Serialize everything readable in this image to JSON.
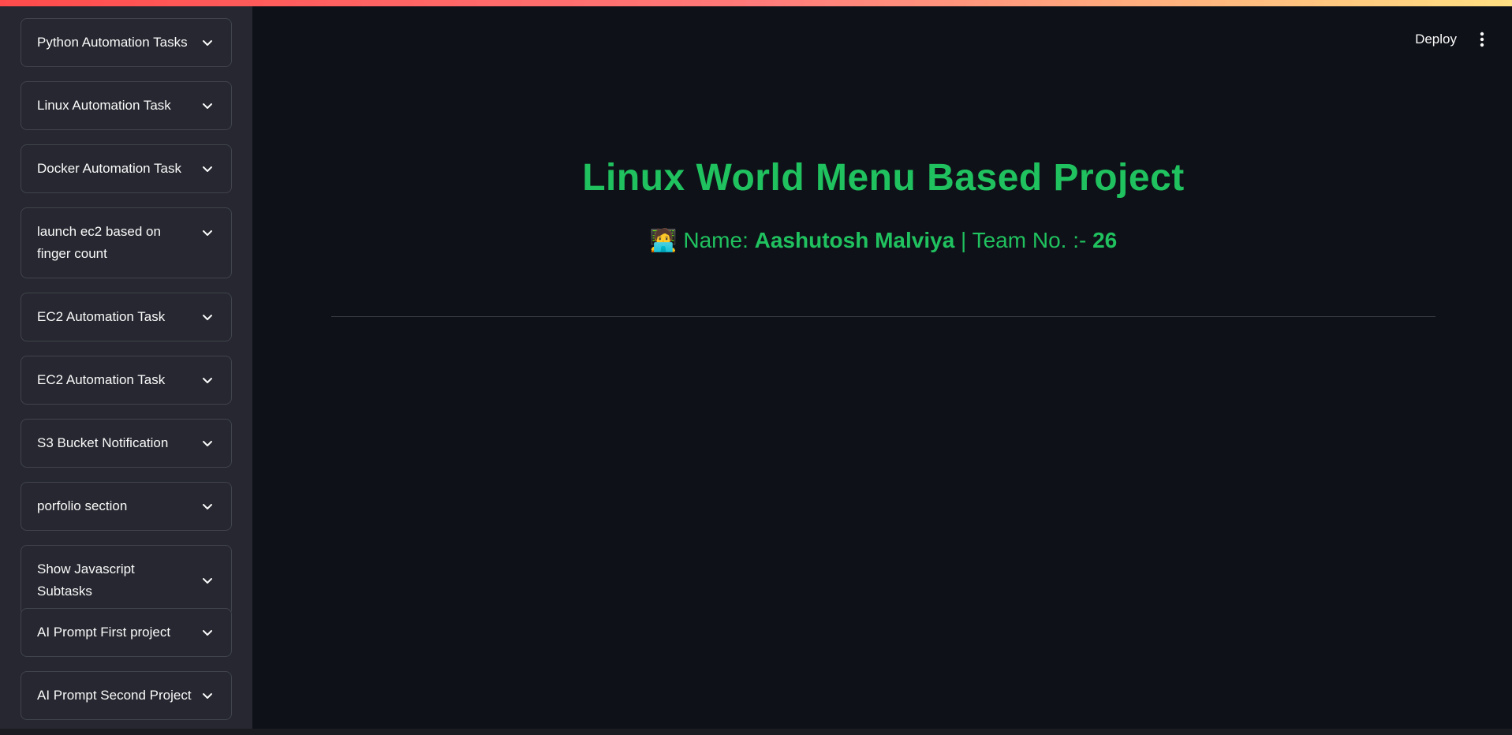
{
  "sidebar": {
    "items": [
      {
        "label": "Python Automation Tasks"
      },
      {
        "label": "Linux Automation Task"
      },
      {
        "label": "Docker Automation Task"
      },
      {
        "label": "launch ec2 based on finger count"
      },
      {
        "label": "EC2 Automation Task"
      },
      {
        "label": "EC2 Automation Task"
      },
      {
        "label": "S3 Bucket Notification"
      },
      {
        "label": "porfolio section"
      },
      {
        "label": "Show Javascript Subtasks"
      },
      {
        "label": "AI Prompt First project"
      },
      {
        "label": "AI Prompt Second Project"
      }
    ]
  },
  "header": {
    "deploy_label": "Deploy",
    "menu_icon": "kebab-menu-icon"
  },
  "main": {
    "title": "Linux World Menu Based Project",
    "subtitle": {
      "emoji": "🧑‍💻",
      "name_prefix": "Name: ",
      "name": "Aashutosh Malviya",
      "separator": " | Team No. :- ",
      "team_no": "26"
    }
  },
  "colors": {
    "accent_green": "#20c15f",
    "background": "#0e1117",
    "sidebar": "#262730"
  }
}
